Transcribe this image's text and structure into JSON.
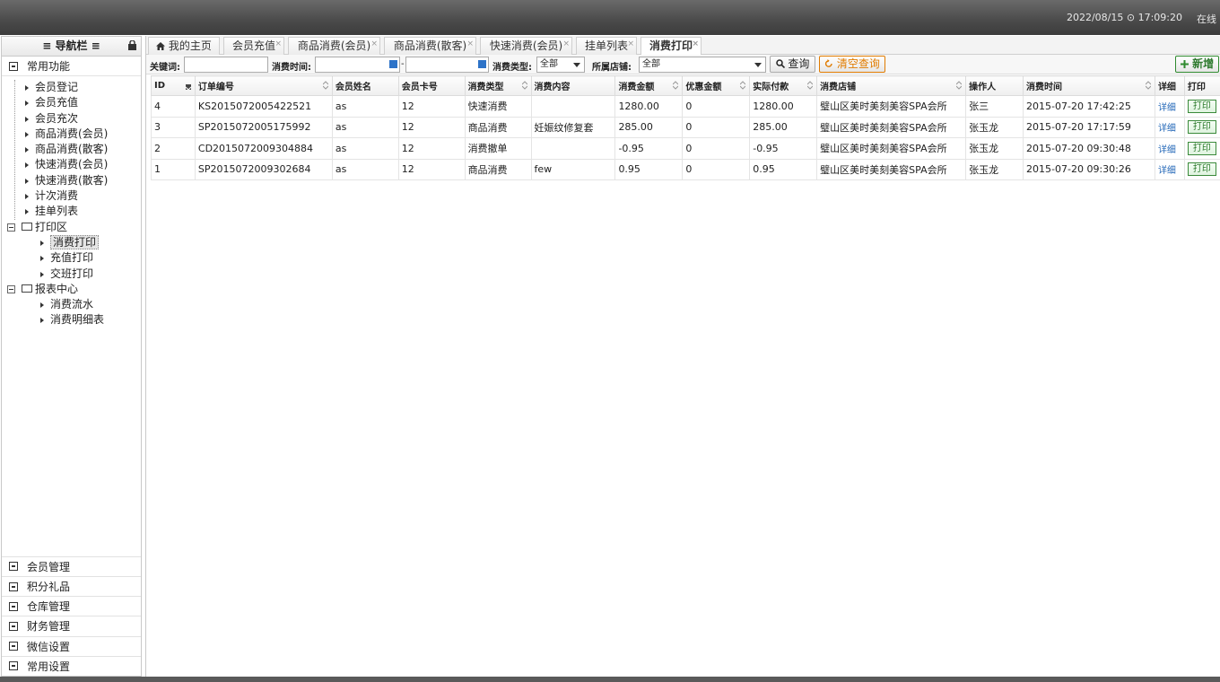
{
  "header": {
    "datetime": "2022/08/15 ⊙ 17:09:20",
    "online": "在线"
  },
  "sidebar": {
    "title": "≡ 导航栏 ≡",
    "common_group": "常用功能",
    "items": [
      "会员登记",
      "会员充值",
      "会员充次",
      "商品消费(会员)",
      "商品消费(散客)",
      "快速消费(会员)",
      "快速消费(散客)",
      "计次消费",
      "挂单列表"
    ],
    "print_folder": "打印区",
    "print_items": [
      "消费打印",
      "充值打印",
      "交班打印"
    ],
    "report_folder": "报表中心",
    "report_items": [
      "消费流水",
      "消费明细表"
    ],
    "bottom_groups": [
      "会员管理",
      "积分礼品",
      "仓库管理",
      "财务管理",
      "微信设置",
      "常用设置"
    ]
  },
  "tabs": [
    {
      "label": "我的主页",
      "icon": "home-icon"
    },
    {
      "label": "会员充值"
    },
    {
      "label": "商品消费(会员)"
    },
    {
      "label": "商品消费(散客)"
    },
    {
      "label": "快速消费(会员)"
    },
    {
      "label": "挂单列表"
    },
    {
      "label": "消费打印",
      "active": true
    }
  ],
  "filters": {
    "keyword_label": "关键词:",
    "keyword_value": "",
    "time_label": "消费时间:",
    "time_from": "",
    "time_to": "",
    "dash": "-",
    "type_label": "消费类型:",
    "type_value": "全部",
    "store_label": "所属店铺:",
    "store_value": "全部",
    "search_btn": "查询",
    "clear_btn": "清空查询",
    "add_btn": "新增"
  },
  "table": {
    "columns": [
      "ID",
      "订单编号",
      "会员姓名",
      "会员卡号",
      "消费类型",
      "消费内容",
      "消费金额",
      "优惠金额",
      "实际付款",
      "消费店铺",
      "操作人",
      "消费时间",
      "详细",
      "打印"
    ],
    "rows": [
      [
        "4",
        "KS2015072005422521",
        "as",
        "12",
        "快速消费",
        "",
        "1280.00",
        "0",
        "1280.00",
        "璧山区美时美刻美容SPA会所",
        "张三",
        "2015-07-20 17:42:25",
        "详细",
        "打印"
      ],
      [
        "3",
        "SP2015072005175992",
        "as",
        "12",
        "商品消费",
        "妊娠纹修复套",
        "285.00",
        "0",
        "285.00",
        "璧山区美时美刻美容SPA会所",
        "张玉龙",
        "2015-07-20 17:17:59",
        "详细",
        "打印"
      ],
      [
        "2",
        "CD2015072009304884",
        "as",
        "12",
        "消费撤单",
        "",
        "-0.95",
        "0",
        "-0.95",
        "璧山区美时美刻美容SPA会所",
        "张玉龙",
        "2015-07-20 09:30:48",
        "详细",
        "打印"
      ],
      [
        "1",
        "SP2015072009302684",
        "as",
        "12",
        "商品消费",
        "few",
        "0.95",
        "0",
        "0.95",
        "璧山区美时美刻美容SPA会所",
        "张玉龙",
        "2015-07-20 09:30:26",
        "详细",
        "打印"
      ]
    ]
  }
}
